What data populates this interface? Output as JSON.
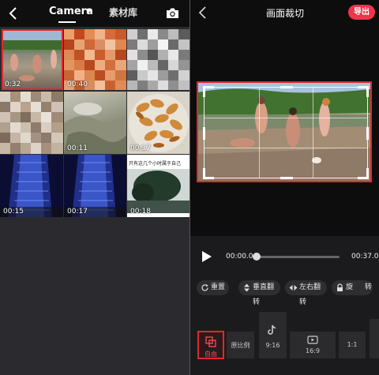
{
  "left_panel": {
    "tabs": {
      "camera": "Camera",
      "materials": "素材库"
    },
    "tiles": [
      {
        "duration": "0:32",
        "selected": true
      },
      {
        "duration": "00:40"
      },
      {
        "duration": ""
      },
      {
        "duration": ""
      },
      {
        "duration": "00:11"
      },
      {
        "duration": "00:17"
      },
      {
        "duration": "00:15"
      },
      {
        "duration": "00:17"
      },
      {
        "duration": "00:18",
        "caption": "只有这几个小时属于自己"
      }
    ]
  },
  "right_panel": {
    "title": "画面裁切",
    "export_label": "导出",
    "player": {
      "current": "00:00.0",
      "total": "00:37.0",
      "progress": 0.0
    },
    "actions": {
      "reset": "重置",
      "flip_vertical": "垂直翻转",
      "flip_horizontal": "左右翻转",
      "rotate_a": "旋",
      "rotate_b": "转"
    },
    "ratios": {
      "free": "自由",
      "original": "原比例",
      "r916": "9:16",
      "r169": "16:9",
      "r11": "1:1"
    }
  },
  "colors": {
    "accent": "#e0282e",
    "export": "#f0344a"
  },
  "icons": [
    "back-icon",
    "camera-icon",
    "play-icon",
    "reset-icon",
    "flip-vertical-icon",
    "flip-horizontal-icon",
    "lock-icon",
    "tiktok-icon",
    "video-icon",
    "crop-free-icon"
  ]
}
